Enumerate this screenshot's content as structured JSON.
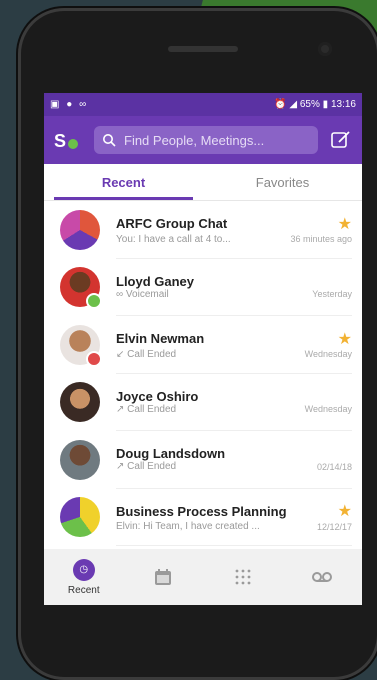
{
  "status": {
    "left_icons": [
      "gallery-icon",
      "sync-icon",
      "voicemail-icon"
    ],
    "battery": "65%",
    "time": "13:16"
  },
  "header": {
    "search_placeholder": "Find People, Meetings..."
  },
  "tabs": {
    "recent": "Recent",
    "favorites": "Favorites"
  },
  "conversations": [
    {
      "name": "ARFC Group Chat",
      "subtitle": "You: I have a call at 4 to...",
      "time": "36 minutes ago",
      "starred": true
    },
    {
      "name": "Lloyd Ganey",
      "subtitle": "Voicemail",
      "time": "Yesterday",
      "starred": false
    },
    {
      "name": "Elvin Newman",
      "subtitle": "Call Ended",
      "time": "Wednesday",
      "starred": true
    },
    {
      "name": "Joyce Oshiro",
      "subtitle": "Call Ended",
      "time": "Wednesday",
      "starred": false
    },
    {
      "name": "Doug Landsdown",
      "subtitle": "Call Ended",
      "time": "02/14/18",
      "starred": false
    },
    {
      "name": "Business Process Planning",
      "subtitle": "Elvin: Hi Team, I have created ...",
      "time": "12/12/17",
      "starred": true
    }
  ],
  "bottom_nav": {
    "recent_label": "Recent"
  },
  "colors": {
    "brand_purple": "#6a3ab2",
    "status_purple": "#5b32a3",
    "star": "#f2b233",
    "online_green": "#6cc04a",
    "dnd_red": "#e04a4a"
  }
}
